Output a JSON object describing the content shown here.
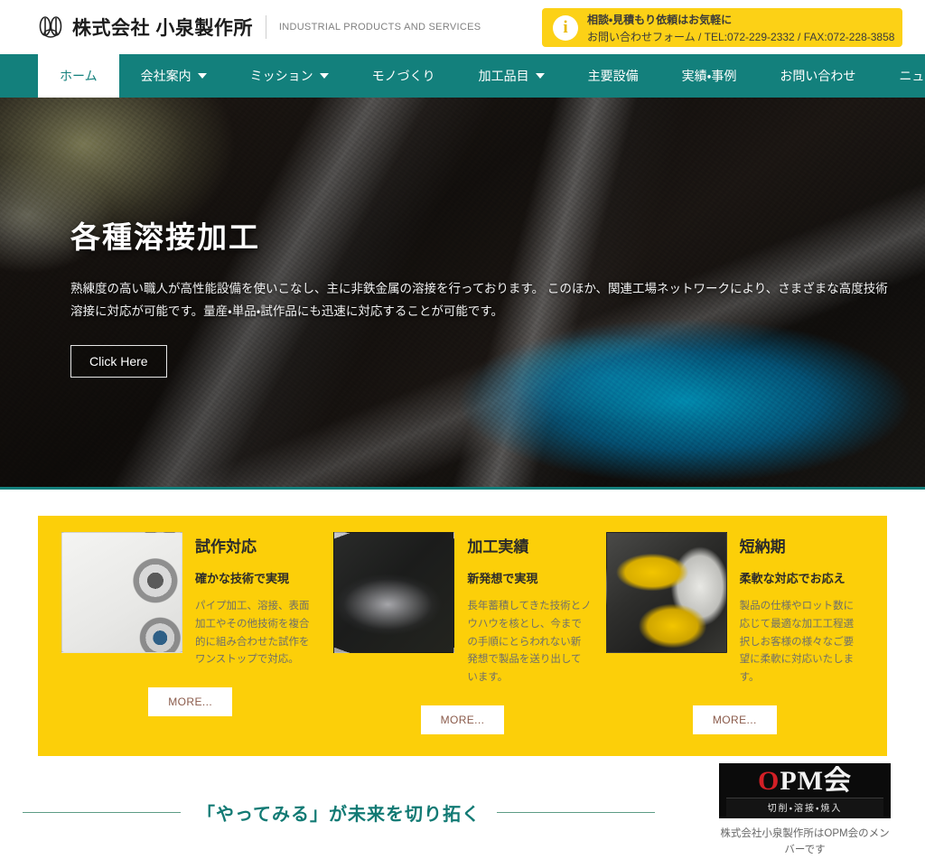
{
  "header": {
    "company_name": "株式会社 小泉製作所",
    "tagline_en": "INDUSTRIAL PRODUCTS AND SERVICES",
    "logo_icon": "koizumi-mark-icon",
    "contact_banner": {
      "icon": "info-circle-icon",
      "line1": "相談・見積もり依頼はお気軽に",
      "line2": "お問い合わせフォーム / TEL:072-229-2332 / FAX:072-228-3858"
    }
  },
  "nav": {
    "items": [
      {
        "label": "ホーム",
        "active": true,
        "dropdown": false
      },
      {
        "label": "会社案内",
        "active": false,
        "dropdown": true
      },
      {
        "label": "ミッション",
        "active": false,
        "dropdown": true
      },
      {
        "label": "モノづくり",
        "active": false,
        "dropdown": false
      },
      {
        "label": "加工品目",
        "active": false,
        "dropdown": true
      },
      {
        "label": "主要設備",
        "active": false,
        "dropdown": false
      },
      {
        "label": "実績・事例",
        "active": false,
        "dropdown": false
      },
      {
        "label": "お問い合わせ",
        "active": false,
        "dropdown": false
      },
      {
        "label": "ニュース",
        "active": false,
        "dropdown": false
      }
    ]
  },
  "hero": {
    "title": "各種溶接加工",
    "description": "熟練度の高い職人が高性能設備を使いこなし、主に非鉄金属の溶接を行っております。 このほか、関連工場ネットワークにより、さまざまな高度技術溶接に対応が可能です。量産・単品・試作品にも迅速に対応することが可能です。",
    "button_label": "Click Here"
  },
  "features": {
    "background_color": "#fccf09",
    "cards": [
      {
        "title": "試作対応",
        "subtitle": "確かな技術で実現",
        "body": "パイプ加工、溶接、表面加工やその他技術を複合的に組み合わせた試作をワンストップで対応。",
        "more_label": "MORE...",
        "thumb": "drafting-gears-photo"
      },
      {
        "title": "加工実績",
        "subtitle": "新発想で実現",
        "body": "長年蓄積してきた技術とノウハウを核とし、今までの手順にとらわれない新発想で製品を送り出しています。",
        "more_label": "MORE...",
        "thumb": "machined-parts-photo"
      },
      {
        "title": "短納期",
        "subtitle": "柔軟な対応でお応え",
        "body": "製品の仕様やロット数に応じて最適な加工工程選択しお客様の様々なご要望に柔軟に対応いたします。",
        "more_label": "MORE...",
        "thumb": "cutting-machine-photo"
      }
    ]
  },
  "bottom": {
    "tagline": "「やってみる」が未来を切り拓く",
    "opm": {
      "logo_o": "O",
      "logo_rest": "PM会",
      "logo_sub": "切削・溶接・焼入",
      "caption": "株式会社小泉製作所はOPM会のメンバーです"
    }
  },
  "colors": {
    "teal": "#13807c",
    "yellow_banner": "#fcd116",
    "yellow_panel": "#fccf09",
    "tagline_teal": "#127a74",
    "opm_red": "#d31f26"
  }
}
